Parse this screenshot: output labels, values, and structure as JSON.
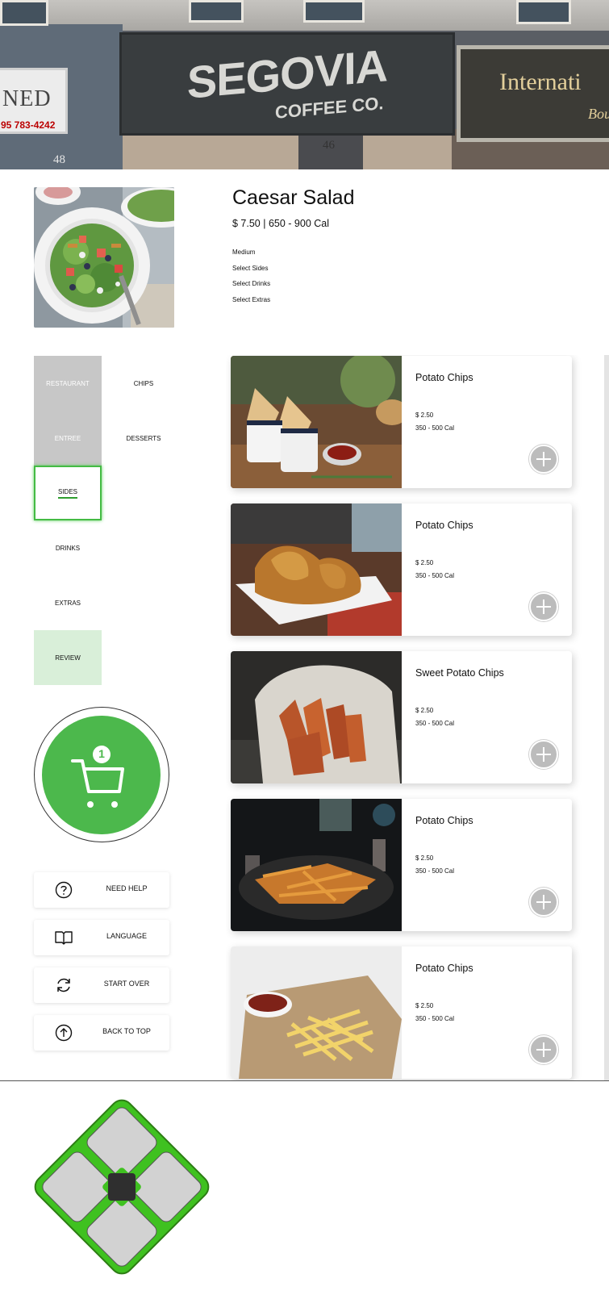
{
  "hero": {
    "sign_main_line1": "SEGOVIA",
    "sign_main_line2": "COFFEE CO.",
    "sign_left_text": "NED",
    "sign_left_phone": "95 783-4242",
    "sign_right_line1": "Internati",
    "sign_right_line2": "Bou",
    "number_left": "48",
    "number_center": "46"
  },
  "item": {
    "title": "Caesar Salad",
    "price_cal": "$ 7.50  |  650 - 900 Cal",
    "options": [
      "Medium",
      "Select Sides",
      "Select Drinks",
      "Select Extras"
    ]
  },
  "nav": {
    "restaurant": "RESTAURANT",
    "chips": "CHIPS",
    "entree": "ENTREE",
    "desserts": "DESSERTS",
    "sides": "SIDES",
    "drinks": "DRINKS",
    "extras": "EXTRAS",
    "review": "REVIEW"
  },
  "cart": {
    "count": "1"
  },
  "actions": {
    "help": "NEED HELP",
    "language": "LANGUAGE",
    "start_over": "START OVER",
    "back_to_top": "BACK TO TOP"
  },
  "products": [
    {
      "name": "Potato Chips",
      "price": "$ 2.50",
      "cal": "350 - 500 Cal"
    },
    {
      "name": "Potato Chips",
      "price": "$ 2.50",
      "cal": "350 - 500 Cal"
    },
    {
      "name": "Sweet Potato Chips",
      "price": "$ 2.50",
      "cal": "350 - 500 Cal"
    },
    {
      "name": "Potato Chips",
      "price": "$ 2.50",
      "cal": "350 - 500 Cal"
    },
    {
      "name": "Potato Chips",
      "price": "$ 2.50",
      "cal": "350 - 500 Cal"
    }
  ],
  "colors": {
    "accent": "#4cb84c",
    "selected_border": "#44bb44",
    "review_bg": "#d9efd9",
    "nav_grey": "#c7c7c7",
    "logo_green": "#3fc120",
    "logo_tile": "#d2d2d2"
  },
  "icons": [
    "question-icon",
    "book-icon",
    "refresh-icon",
    "arrow-up-icon",
    "cart-icon",
    "plus-icon"
  ]
}
